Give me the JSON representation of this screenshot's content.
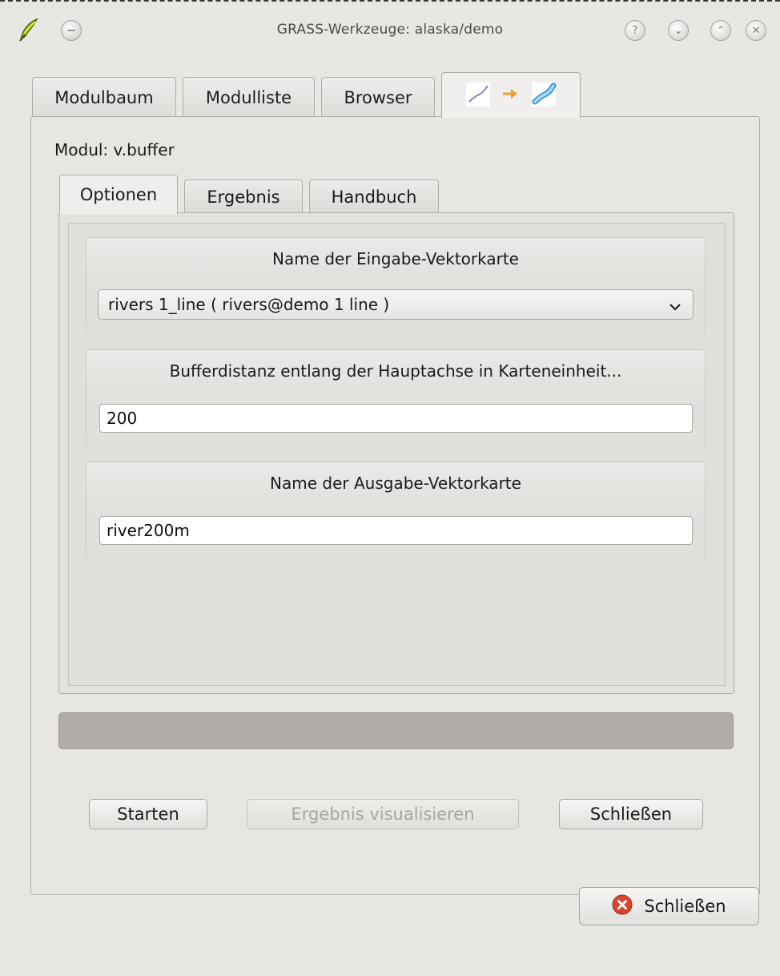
{
  "window": {
    "title": "GRASS-Werkzeuge: alaska/demo",
    "buttons": {
      "help": "?",
      "minimize": "⌄",
      "maximize": "⌃",
      "close": "✕"
    }
  },
  "outer_tabs": [
    {
      "label": "Modulbaum",
      "active": false
    },
    {
      "label": "Modulliste",
      "active": false
    },
    {
      "label": "Browser",
      "active": false
    },
    {
      "label": "",
      "icon": "line-to-buffer-icon",
      "active": true
    }
  ],
  "module": {
    "label": "Modul: v.buffer"
  },
  "inner_tabs": [
    {
      "label": "Optionen",
      "active": true
    },
    {
      "label": "Ergebnis",
      "active": false
    },
    {
      "label": "Handbuch",
      "active": false
    }
  ],
  "options": {
    "input_map": {
      "title": "Name der Eingabe-Vektorkarte",
      "selected": "rivers 1_line ( rivers@demo 1 line )"
    },
    "buffer_distance": {
      "title": "Bufferdistanz entlang der Hauptachse in Karteneinheit...",
      "value": "200"
    },
    "output_map": {
      "title": "Name der Ausgabe-Vektorkarte",
      "value": "river200m"
    }
  },
  "actions": {
    "run": "Starten",
    "view_output": "Ergebnis visualisieren",
    "close": "Schließen"
  },
  "footer": {
    "close": "Schließen"
  },
  "colors": {
    "window_bg": "#e9e7e4",
    "progress_bg": "#b3adaa",
    "close_icon": "#d9452c",
    "arrow": "#f0a030"
  }
}
